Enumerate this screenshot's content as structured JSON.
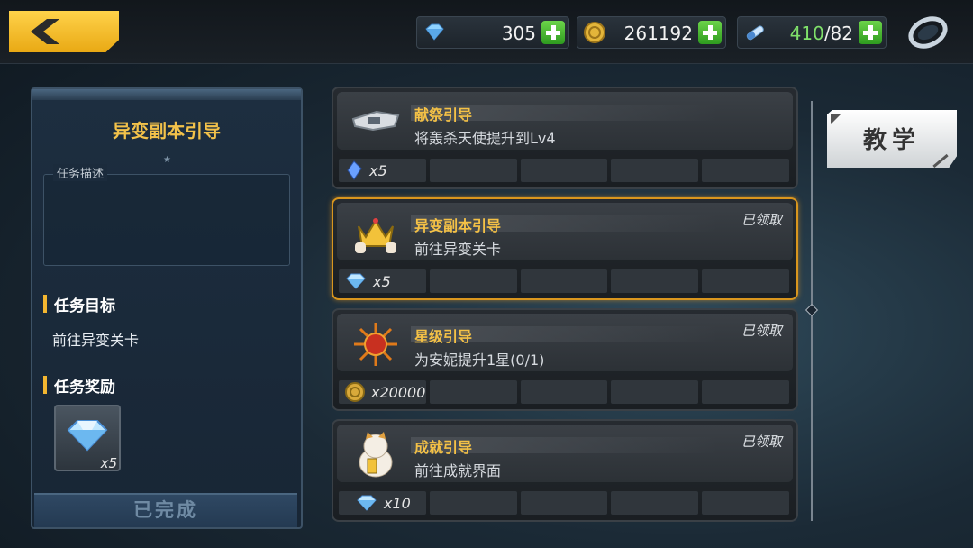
{
  "header": {
    "back_icon": "chevron-left-icon",
    "resources": [
      {
        "icon": "diamond-icon",
        "value": "305"
      },
      {
        "icon": "gold-coin-icon",
        "value": "261192"
      },
      {
        "icon": "energy-capsule-icon",
        "value_current": "410",
        "value_max": "/82"
      }
    ],
    "ring_icon": "ring-icon"
  },
  "left_panel": {
    "title": "异变副本引导",
    "desc_label": "任务描述",
    "desc_text": "",
    "goal_heading": "任务目标",
    "goal_text": "前往异变关卡",
    "reward_heading": "任务奖励",
    "reward_icon": "diamond-icon",
    "reward_count": "x5",
    "status_button": "已完成"
  },
  "tasks": [
    {
      "name": "献祭引导",
      "desc": "将轰杀天使提升到Lv4",
      "claimed": "",
      "icon": "wing-weapon-icon",
      "reward_icon": "blue-crystal-icon",
      "reward_count": "x5",
      "selected": false
    },
    {
      "name": "异变副本引导",
      "desc": "前往异变关卡",
      "claimed": "已领取",
      "icon": "crown-icon",
      "reward_icon": "diamond-icon",
      "reward_count": "x5",
      "selected": true
    },
    {
      "name": "星级引导",
      "desc": "为安妮提升1星(0/1)",
      "claimed": "已领取",
      "icon": "sun-star-icon",
      "reward_icon": "gold-coin-icon",
      "reward_count": "x20000",
      "selected": false
    },
    {
      "name": "成就引导",
      "desc": "前往成就界面",
      "claimed": "已领取",
      "icon": "lucky-cat-icon",
      "reward_icon": "diamond-icon",
      "reward_count": "x10",
      "selected": false
    }
  ],
  "teach_button": "教学",
  "colors": {
    "accent_gold": "#f4c146",
    "selected_border": "#d9961e",
    "plus_green": "#4fbf34"
  }
}
